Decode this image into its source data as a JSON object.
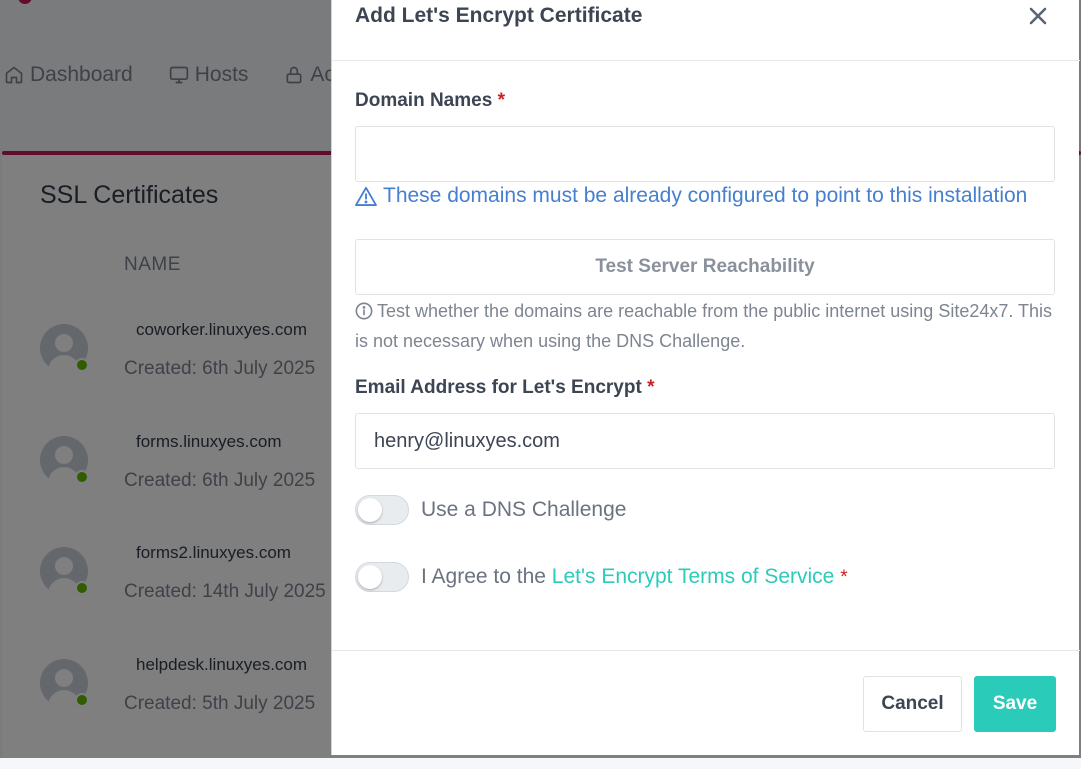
{
  "nav": {
    "items": [
      {
        "label": "Dashboard",
        "icon": "home-icon"
      },
      {
        "label": "Hosts",
        "icon": "monitor-icon"
      },
      {
        "label": "Ac",
        "icon": "lock-icon"
      }
    ]
  },
  "page": {
    "title": "SSL Certificates",
    "column_name": "NAME",
    "rows": [
      {
        "domain": "coworker.linuxyes.com",
        "created": "Created: 6th July 2025"
      },
      {
        "domain": "forms.linuxyes.com",
        "created": "Created: 6th July 2025"
      },
      {
        "domain": "forms2.linuxyes.com",
        "created": "Created: 14th July 2025"
      },
      {
        "domain": "helpdesk.linuxyes.com",
        "created": "Created: 5th July 2025"
      }
    ]
  },
  "modal": {
    "title": "Add Let's Encrypt Certificate",
    "domain_names": {
      "label": "Domain Names",
      "required_mark": "*",
      "value": "",
      "warning": "These domains must be already configured to point to this installation"
    },
    "test_button": "Test Server Reachability",
    "test_hint": "Test whether the domains are reachable from the public internet using Site24x7. This is not necessary when using the DNS Challenge.",
    "email": {
      "label": "Email Address for Let's Encrypt",
      "required_mark": "*",
      "value": "henry@linuxyes.com"
    },
    "dns_toggle": {
      "label": "Use a DNS Challenge",
      "on": false
    },
    "tos_toggle": {
      "label_prefix": "I Agree to the",
      "link_text": "Let's Encrypt Terms of Service",
      "required_mark": "*",
      "on": false
    },
    "cancel_button": "Cancel",
    "save_button": "Save"
  },
  "colors": {
    "accent": "#2bcbba",
    "link_blue": "#467fcf",
    "required": "#cd201f",
    "brand_pink": "#c2185b",
    "online": "#5eba00"
  }
}
